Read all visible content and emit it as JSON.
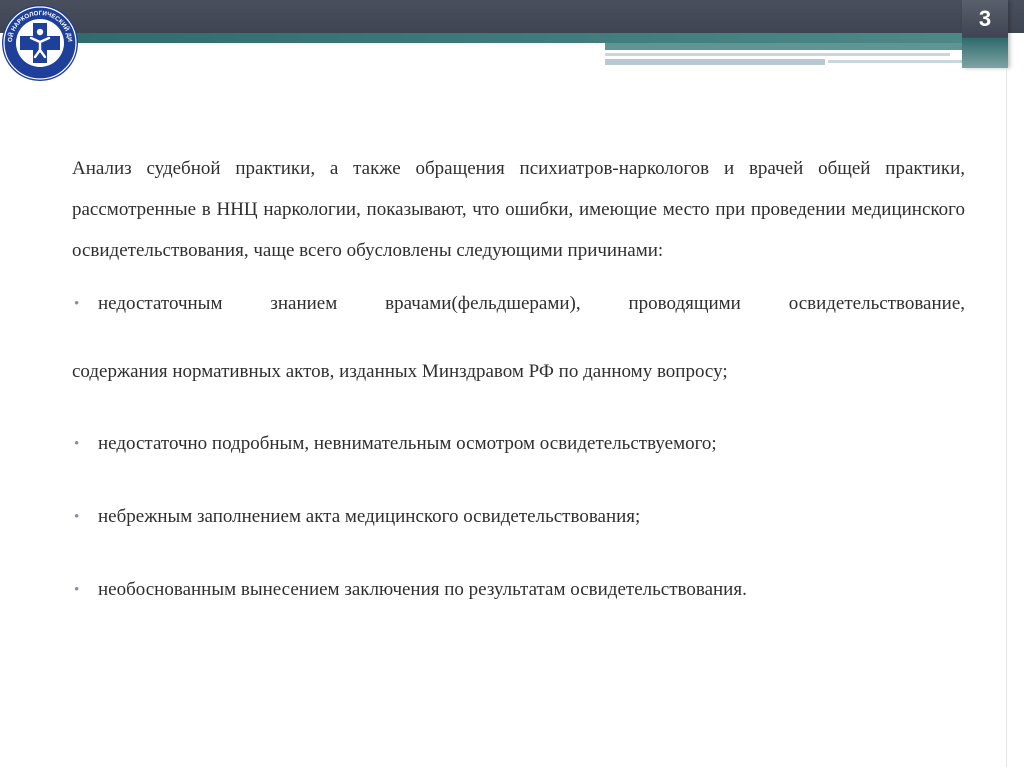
{
  "slide": {
    "number": "3",
    "colors": {
      "header": "#3f4452",
      "accent": "#2e6b6b",
      "accent_light": "#5d9694",
      "bullet": "#8a8aa8",
      "text": "#2f2f2f"
    }
  },
  "logo": {
    "icon": "medical-cross-person-emblem",
    "ring_text": "ОБЛАСТНОЙ НАРКОЛОГИЧЕСКИЙ ДИСПАНСЕР"
  },
  "body": {
    "intro": "Анализ судебной практики, а также обращения психиатров-наркологов и врачей общей практики, рассмотренные в ННЦ наркологии, показывают, что ошибки, имеющие место при проведении медицинского освидетельствования, чаще всего обусловлены следующими причинами:",
    "bullet_1_line_1": "недостаточным знанием врачами(фельдшерами), проводящими освидетельствование,",
    "bullet_1_line_2": "содержания нормативных актов, изданных Минздравом РФ по данному вопросу;",
    "bullet_2": "недостаточно подробным, невнимательным осмотром освидетельствуемого;",
    "bullet_3": "небрежным заполнением акта медицинского освидетельствования;",
    "bullet_4": "необоснованным вынесением заключения по результатам освидетельствования."
  }
}
